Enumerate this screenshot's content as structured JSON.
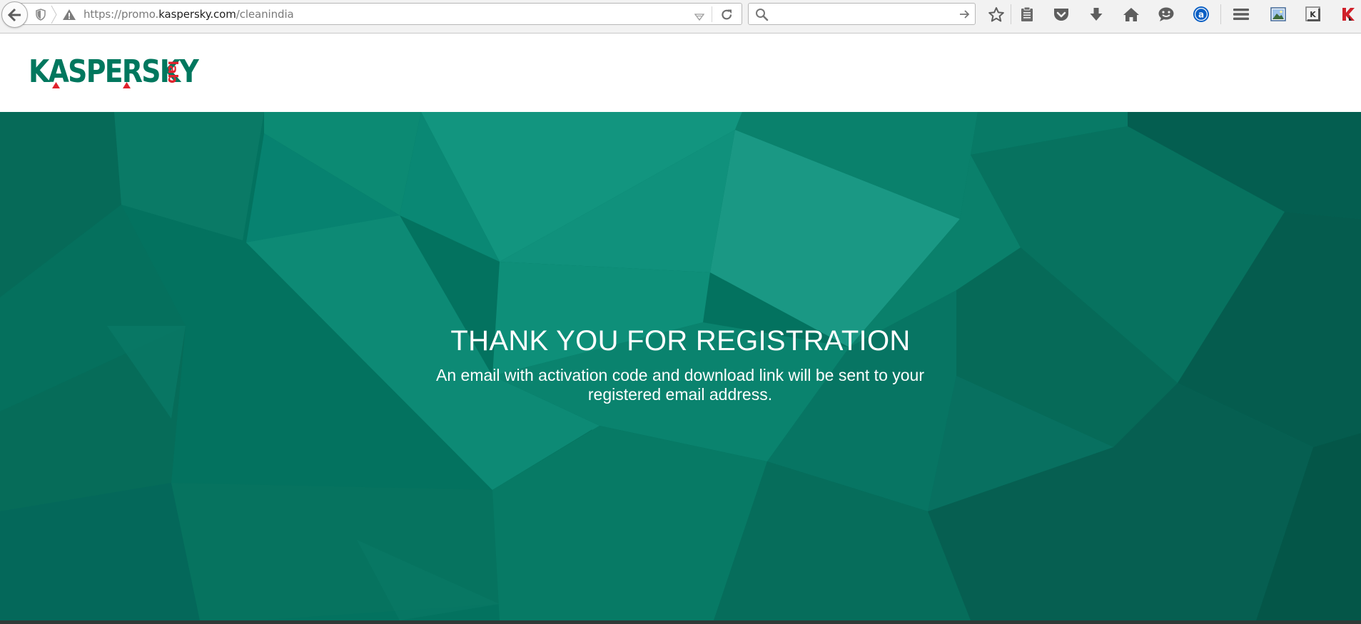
{
  "browser": {
    "url_prefix": "https://promo.",
    "url_domain": "kaspersky.com",
    "url_path": "/cleanindia",
    "search_value": "",
    "icons": [
      "back-icon",
      "shield-icon",
      "warning-icon",
      "dropdown-icon",
      "reload-icon",
      "search-icon",
      "go-arrow-icon",
      "bookmark-star-icon",
      "reader-list-icon",
      "pocket-icon",
      "download-icon",
      "home-icon",
      "chat-icon",
      "addon-a-icon",
      "menu-icon",
      "image-icon",
      "kaspersky-k-icon",
      "kaspersky-red-icon"
    ]
  },
  "site": {
    "logo_word": "KASPERSKY",
    "logo_sub": "lab",
    "brand_color": "#00775e",
    "accent_color": "#e0232d"
  },
  "hero": {
    "title": "THANK YOU FOR REGISTRATION",
    "message": "An email with activation code and download link will be sent to your registered email address.",
    "background_color": "#03725f"
  }
}
